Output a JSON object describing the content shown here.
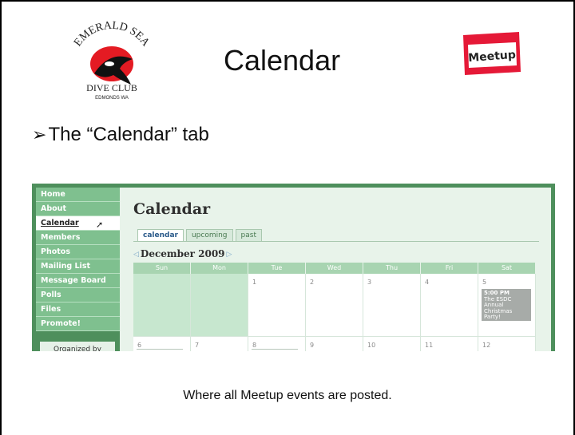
{
  "slide": {
    "title": "Calendar",
    "bullet": "The “Calendar” tab",
    "caption": "Where all Meetup events are posted."
  },
  "logo": {
    "top_text": "EMERALD SEA",
    "bottom_text": "DIVE CLUB",
    "location": "EDMONDS WA",
    "icon": "orca-icon"
  },
  "meetup_logo": {
    "text": "Meetup",
    "color": "#e51937"
  },
  "screenshot": {
    "nav": [
      {
        "label": "Home"
      },
      {
        "label": "About"
      },
      {
        "label": "Calendar"
      },
      {
        "label": "Members"
      },
      {
        "label": "Photos"
      },
      {
        "label": "Mailing List"
      },
      {
        "label": "Message Board"
      },
      {
        "label": "Polls"
      },
      {
        "label": "Files"
      },
      {
        "label": "Promote!"
      }
    ],
    "organized_by": "Organized by",
    "page_title": "Calendar",
    "tabs": [
      {
        "label": "calendar"
      },
      {
        "label": "upcoming"
      },
      {
        "label": "past"
      }
    ],
    "month": "December 2009",
    "weekdays": [
      "Sun",
      "Mon",
      "Tue",
      "Wed",
      "Thu",
      "Fri",
      "Sat"
    ],
    "week1": [
      "",
      "",
      "1",
      "2",
      "3",
      "4",
      "5"
    ],
    "week2": [
      "6",
      "7",
      "8",
      "9",
      "10",
      "11",
      "12"
    ],
    "event": {
      "time": "5:00 PM",
      "title": "The ESDC Annual Christmas Party!"
    }
  }
}
